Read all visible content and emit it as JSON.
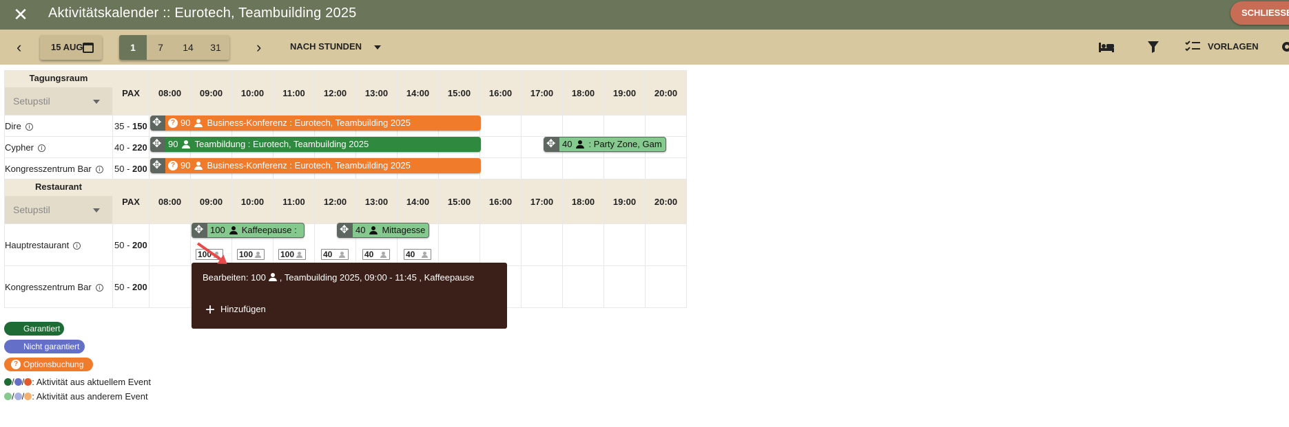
{
  "window": {
    "title": "Aktivitätskalender :: Eurotech, Teambuilding 2025",
    "close_label": "SCHLIESSEN"
  },
  "toolbar": {
    "date_label": "15 AUG",
    "range_options": [
      "1",
      "7",
      "14",
      "31"
    ],
    "range_selected": "1",
    "mode_label": "NACH STUNDEN",
    "templates_label": "VORLAGEN"
  },
  "hours": [
    "08:00",
    "09:00",
    "10:00",
    "11:00",
    "12:00",
    "13:00",
    "14:00",
    "15:00",
    "16:00",
    "17:00",
    "18:00",
    "19:00",
    "20:00"
  ],
  "pax_header": "PAX",
  "setup_placeholder": "Setupstil",
  "sections": [
    {
      "name": "Tagungsraum",
      "rooms": [
        {
          "name": "Dire",
          "pax_min": "35",
          "pax_max": "150"
        },
        {
          "name": "Cypher",
          "pax_min": "40",
          "pax_max": "220"
        },
        {
          "name": "Kongresszentrum Bar",
          "pax_min": "50",
          "pax_max": "200"
        }
      ]
    },
    {
      "name": "Restaurant",
      "rooms": [
        {
          "name": "Hauptrestaurant",
          "pax_min": "50",
          "pax_max": "200"
        },
        {
          "name": "Kongresszentrum Bar",
          "pax_min": "50",
          "pax_max": "200"
        }
      ]
    }
  ],
  "events": [
    {
      "pax": "90",
      "label": "Business-Konferenz : Eurotech, Teambuilding 2025",
      "color": "#f07b2b",
      "optional": true
    },
    {
      "pax": "90",
      "label": "Teambildung : Eurotech, Teambuilding 2025",
      "color": "#2f8a3f",
      "optional": false
    },
    {
      "pax": "40",
      "label": ": Party Zone, Gam",
      "color": "#86c98e",
      "optional": false
    },
    {
      "pax": "90",
      "label": "Business-Konferenz : Eurotech, Teambuilding 2025",
      "color": "#f07b2b",
      "optional": true
    },
    {
      "pax": "100",
      "label": "Kaffeepause :",
      "color": "#86c98e",
      "optional": false
    },
    {
      "pax": "40",
      "label": "Mittagesse",
      "color": "#86c98e",
      "optional": false
    }
  ],
  "chips": [
    "100",
    "100",
    "100",
    "40",
    "40",
    "40"
  ],
  "tooltip": {
    "edit_prefix": "Bearbeiten: 100",
    "edit_suffix": ", Teambuilding 2025, 09:00 - 11:45  , Kaffeepause",
    "add_label": "Hinzufügen"
  },
  "legend": {
    "guaranteed": "Garantiert",
    "not_guaranteed": "Nicht garantiert",
    "option": "Optionsbuchung",
    "current_event": ": Aktivität aus aktuellem Event",
    "other_event": ": Aktivität aus anderem Event"
  }
}
